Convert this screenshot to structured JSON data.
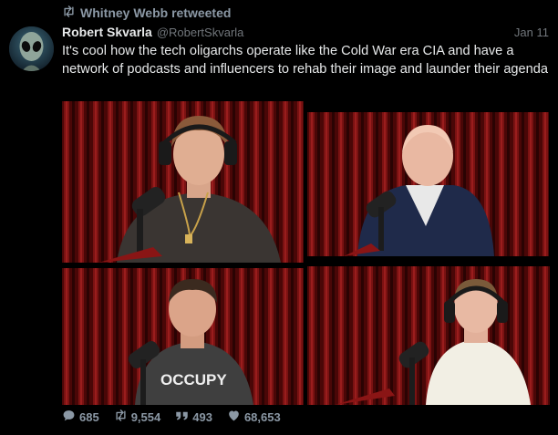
{
  "retweet": {
    "label": "Whitney Webb retweeted",
    "icon": "retweet-icon"
  },
  "author": {
    "name": "Robert Skvarla",
    "handle": "@RobertSkvarla",
    "avatar_icon": "alien-avatar"
  },
  "tweet": {
    "date": "Jan 11",
    "text": "It's cool how the tech oligarchs operate like the Cold War era CIA and have a network of podcasts and influencers to rehab their image and launder their agenda"
  },
  "media": {
    "panels": [
      {
        "name": "podcast-photo-1"
      },
      {
        "name": "podcast-photo-2"
      },
      {
        "name": "podcast-photo-3",
        "shirt_text": "OCCUPY"
      },
      {
        "name": "podcast-photo-4"
      }
    ]
  },
  "stats": {
    "replies": "685",
    "retweets": "9,554",
    "quotes": "493",
    "likes": "68,653"
  },
  "colors": {
    "background": "#000000",
    "text": "#e7e9ea",
    "muted": "#8b98a5",
    "curtain": "#5c0a0a"
  }
}
